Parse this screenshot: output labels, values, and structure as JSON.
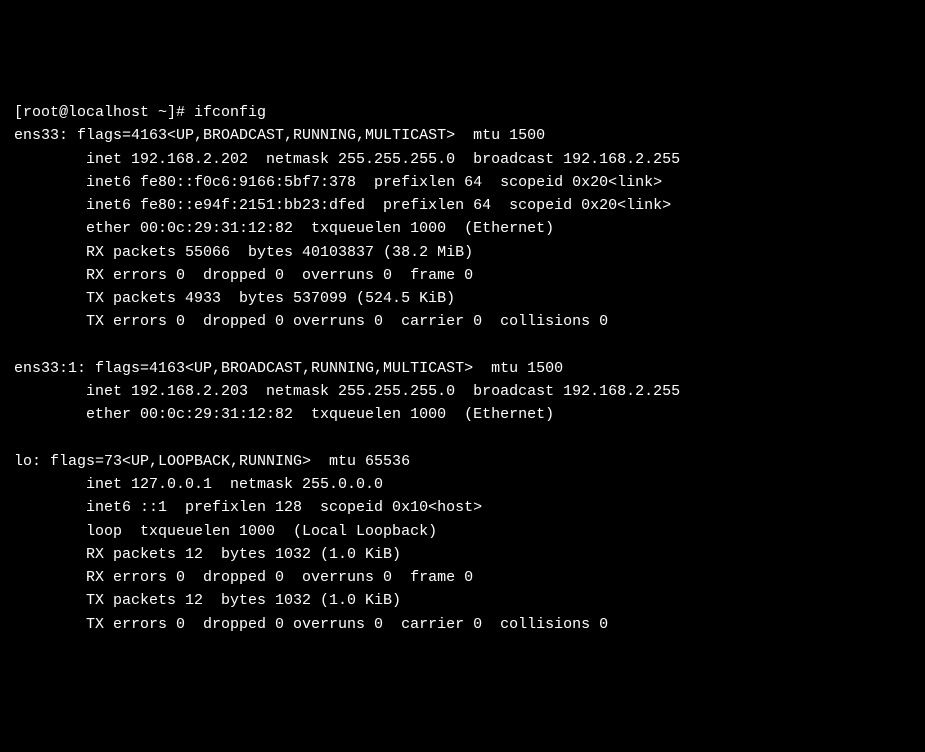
{
  "prompt": "[root@localhost ~]# ",
  "command": "ifconfig",
  "interfaces": {
    "ens33": {
      "header": "ens33: flags=4163<UP,BROADCAST,RUNNING,MULTICAST>  mtu 1500",
      "inet": "        inet 192.168.2.202  netmask 255.255.255.0  broadcast 192.168.2.255",
      "inet6a": "        inet6 fe80::f0c6:9166:5bf7:378  prefixlen 64  scopeid 0x20<link>",
      "inet6b": "        inet6 fe80::e94f:2151:bb23:dfed  prefixlen 64  scopeid 0x20<link>",
      "ether": "        ether 00:0c:29:31:12:82  txqueuelen 1000  (Ethernet)",
      "rxp": "        RX packets 55066  bytes 40103837 (38.2 MiB)",
      "rxe": "        RX errors 0  dropped 0  overruns 0  frame 0",
      "txp": "        TX packets 4933  bytes 537099 (524.5 KiB)",
      "txe": "        TX errors 0  dropped 0 overruns 0  carrier 0  collisions 0"
    },
    "ens33_1": {
      "header": "ens33:1: flags=4163<UP,BROADCAST,RUNNING,MULTICAST>  mtu 1500",
      "inet": "        inet 192.168.2.203  netmask 255.255.255.0  broadcast 192.168.2.255",
      "ether": "        ether 00:0c:29:31:12:82  txqueuelen 1000  (Ethernet)"
    },
    "lo": {
      "header": "lo: flags=73<UP,LOOPBACK,RUNNING>  mtu 65536",
      "inet": "        inet 127.0.0.1  netmask 255.0.0.0",
      "inet6": "        inet6 ::1  prefixlen 128  scopeid 0x10<host>",
      "loop": "        loop  txqueuelen 1000  (Local Loopback)",
      "rxp": "        RX packets 12  bytes 1032 (1.0 KiB)",
      "rxe": "        RX errors 0  dropped 0  overruns 0  frame 0",
      "txp": "        TX packets 12  bytes 1032 (1.0 KiB)",
      "txe": "        TX errors 0  dropped 0 overruns 0  carrier 0  collisions 0"
    }
  }
}
